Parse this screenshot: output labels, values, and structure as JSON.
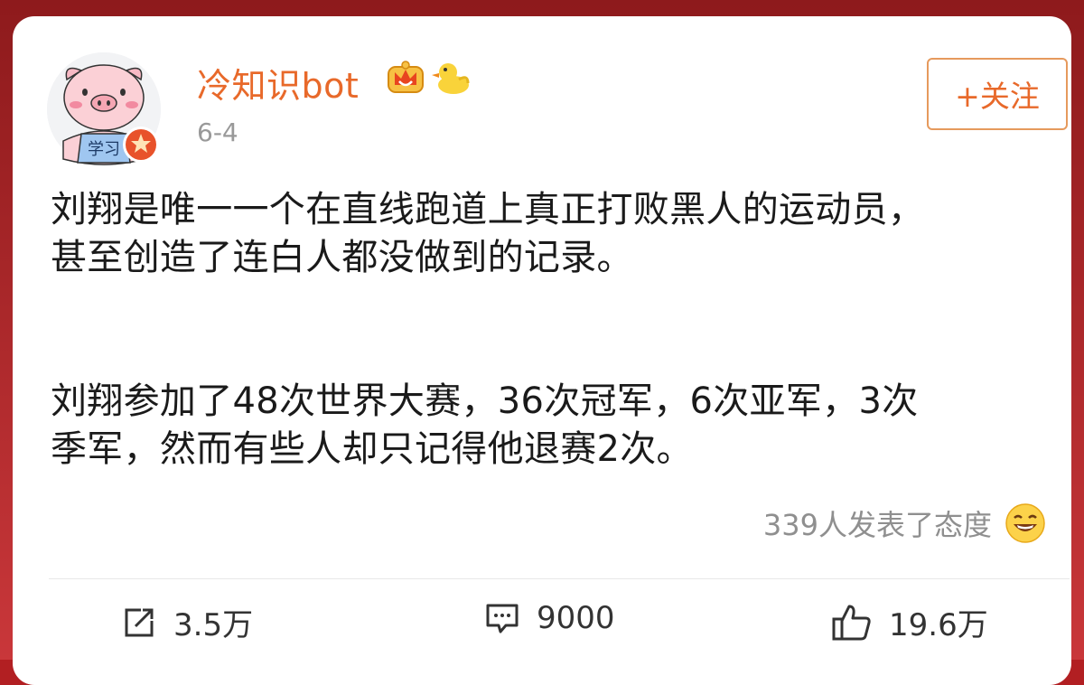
{
  "post": {
    "username": "冷知识bot",
    "date": "6-4",
    "follow_label": "+关注",
    "paragraphs": [
      "刘翔是唯一一个在直线跑道上真正打败黑人的运动员，\n甚至创造了连白人都没做到的记录。",
      "刘翔参加了48次世界大赛，36次冠军，6次亚军，3次\n季军，然而有些人却只记得他退赛2次。"
    ],
    "reactions_text": "339人发表了态度",
    "reaction_icon": "laughing-emoji-icon",
    "avatar_icon": "pig-reading-avatar",
    "avatar_label": "学习",
    "badges": [
      "crown-badge-icon",
      "duck-badge-icon"
    ]
  },
  "actions": {
    "share": {
      "icon": "share-icon",
      "count": "3.5万"
    },
    "comment": {
      "icon": "comment-icon",
      "count": "9000"
    },
    "like": {
      "icon": "like-icon",
      "count": "19.6万"
    }
  },
  "colors": {
    "frame": "#b21f22",
    "username": "#e8692a",
    "follow_border": "#e69a5d",
    "meta_text": "#999999"
  }
}
